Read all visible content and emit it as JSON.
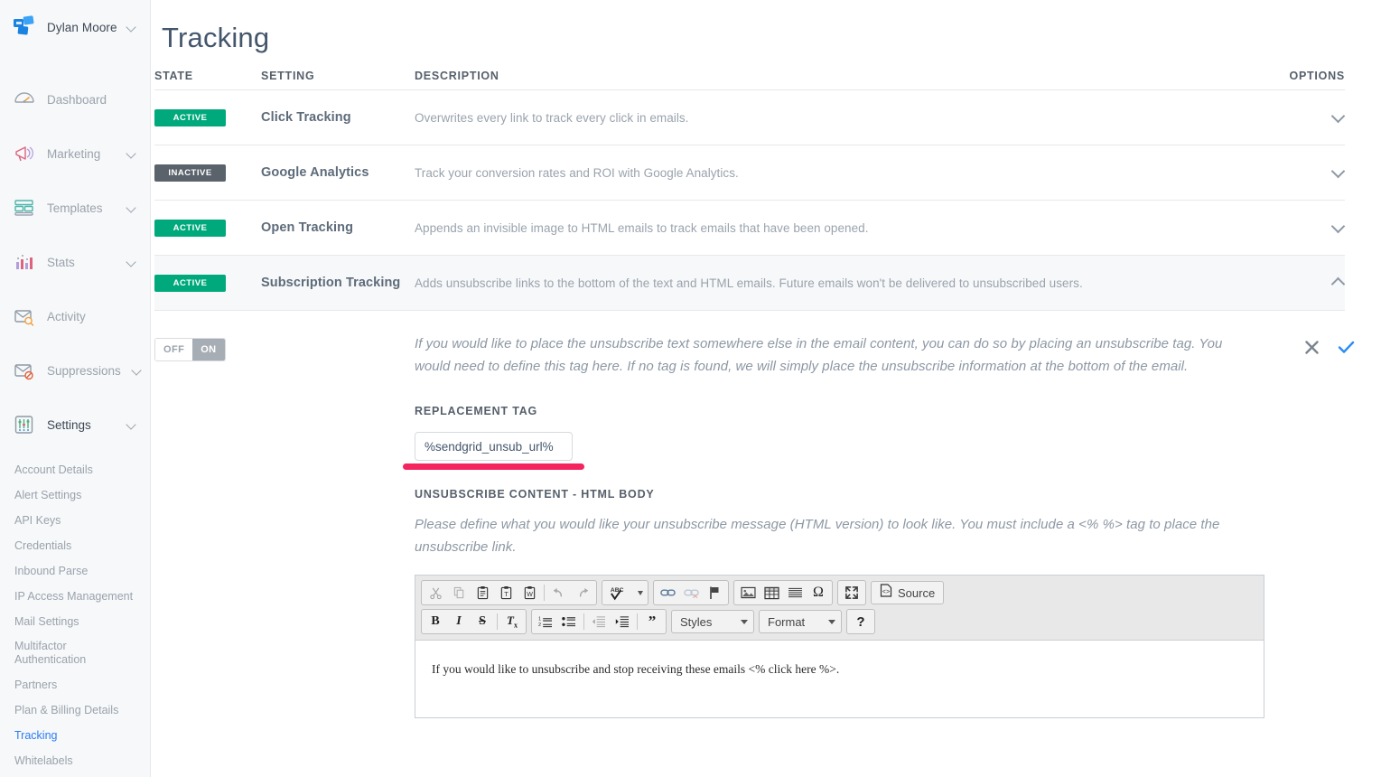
{
  "sidebar": {
    "account": {
      "name": "Dylan Moore",
      "logo_icon": "sendgrid-logo-icon",
      "chevron_icon": "chevron-down-icon"
    },
    "items": [
      {
        "label": "Dashboard",
        "icon": "gauge-icon",
        "has_chevron": false
      },
      {
        "label": "Marketing",
        "icon": "megaphone-icon",
        "has_chevron": true
      },
      {
        "label": "Templates",
        "icon": "template-icon",
        "has_chevron": true
      },
      {
        "label": "Stats",
        "icon": "bar-chart-icon",
        "has_chevron": true
      },
      {
        "label": "Activity",
        "icon": "envelope-search-icon",
        "has_chevron": false
      },
      {
        "label": "Suppressions",
        "icon": "envelope-block-icon",
        "has_chevron": true
      },
      {
        "label": "Settings",
        "icon": "sliders-icon",
        "has_chevron": true
      }
    ],
    "settings_subitems": [
      {
        "label": "Account Details",
        "selected": false
      },
      {
        "label": "Alert Settings",
        "selected": false
      },
      {
        "label": "API Keys",
        "selected": false
      },
      {
        "label": "Credentials",
        "selected": false
      },
      {
        "label": "Inbound Parse",
        "selected": false
      },
      {
        "label": "IP Access Management",
        "selected": false
      },
      {
        "label": "Mail Settings",
        "selected": false
      },
      {
        "label": "Multifactor Authentication",
        "selected": false
      },
      {
        "label": "Partners",
        "selected": false
      },
      {
        "label": "Plan & Billing Details",
        "selected": false
      },
      {
        "label": "Tracking",
        "selected": true
      },
      {
        "label": "Whitelabels",
        "selected": false
      }
    ]
  },
  "page": {
    "title": "Tracking"
  },
  "table": {
    "headers": {
      "state": "STATE",
      "setting": "SETTING",
      "description": "DESCRIPTION",
      "options": "OPTIONS"
    },
    "rows": [
      {
        "state": "ACTIVE",
        "state_kind": "active",
        "setting": "Click Tracking",
        "description": "Overwrites every link to track every click in emails.",
        "chevron": "chevron-down-icon",
        "expanded": false
      },
      {
        "state": "INACTIVE",
        "state_kind": "inactive",
        "setting": "Google Analytics",
        "description": "Track your conversion rates and ROI with Google Analytics.",
        "chevron": "chevron-down-icon",
        "expanded": false
      },
      {
        "state": "ACTIVE",
        "state_kind": "active",
        "setting": "Open Tracking",
        "description": "Appends an invisible image to HTML emails to track emails that have been opened.",
        "chevron": "chevron-down-icon",
        "expanded": false
      },
      {
        "state": "ACTIVE",
        "state_kind": "active",
        "setting": "Subscription Tracking",
        "description": "Adds unsubscribe links to the bottom of the text and HTML emails. Future emails won't be delivered to unsubscribed users.",
        "chevron": "chevron-up-icon",
        "expanded": true
      }
    ]
  },
  "expanded_panel": {
    "toggle": {
      "off_label": "OFF",
      "on_label": "ON",
      "value": "ON"
    },
    "intro_note": "If you would like to place the unsubscribe text somewhere else in the email content, you can do so by placing an unsubscribe tag. You would need to define this tag here. If no tag is found, we will simply place the unsubscribe information at the bottom of the email.",
    "replacement_tag": {
      "label": "REPLACEMENT TAG",
      "value": "%sendgrid_unsub_url%",
      "placeholder": "%sendgrid_unsub_url%",
      "underline_color": "#f4245e"
    },
    "unsubscribe_content": {
      "label": "UNSUBSCRIBE CONTENT - HTML BODY",
      "note": "Please define what you would like your unsubscribe message (HTML version) to look like. You must include a <% %> tag to place the unsubscribe link."
    },
    "actions": {
      "cancel_icon": "close-x-icon",
      "confirm_icon": "check-icon",
      "cancel_color": "#7b858f",
      "confirm_color": "#2a8cf6"
    }
  },
  "editor": {
    "toolbar_row1": [
      {
        "icon": "cut-icon",
        "glyph": "✂",
        "disabled": true
      },
      {
        "icon": "copy-icon",
        "glyph": "❐",
        "disabled": true
      },
      {
        "icon": "paste-icon",
        "glyph": "ὌB",
        "disabled": false
      },
      {
        "icon": "paste-as-text-icon",
        "glyph": "T",
        "disabled": false
      },
      {
        "icon": "paste-from-word-icon",
        "glyph": "W",
        "disabled": false
      },
      {
        "icon": "undo-icon",
        "glyph": "↶",
        "disabled": true
      },
      {
        "icon": "redo-icon",
        "glyph": "↷",
        "disabled": true
      },
      {
        "icon": "spell-check-icon",
        "glyph": "ABC",
        "disabled": false
      },
      {
        "icon": "link-icon",
        "glyph": "ὑ7",
        "disabled": false
      },
      {
        "icon": "unlink-icon",
        "glyph": "ὑ7",
        "disabled": true
      },
      {
        "icon": "anchor-flag-icon",
        "glyph": "⚑",
        "disabled": false
      },
      {
        "icon": "image-icon",
        "glyph": "ὛC",
        "disabled": false
      },
      {
        "icon": "table-icon",
        "glyph": "⊞",
        "disabled": false
      },
      {
        "icon": "horizontal-rule-icon",
        "glyph": "≡",
        "disabled": false
      },
      {
        "icon": "special-char-icon",
        "glyph": "Ω",
        "disabled": false
      },
      {
        "icon": "maximize-icon",
        "glyph": "⤢",
        "disabled": false
      }
    ],
    "source_button": {
      "label": "Source",
      "icon": "source-code-icon"
    },
    "toolbar_row2": [
      {
        "icon": "bold-icon",
        "glyph": "B",
        "disabled": false
      },
      {
        "icon": "italic-icon",
        "glyph": "I",
        "disabled": false
      },
      {
        "icon": "strikethrough-icon",
        "glyph": "S",
        "disabled": false
      },
      {
        "icon": "remove-format-icon",
        "glyph": "Tx",
        "disabled": false
      },
      {
        "icon": "numbered-list-icon",
        "glyph": "1.",
        "disabled": false
      },
      {
        "icon": "bulleted-list-icon",
        "glyph": "•",
        "disabled": false
      },
      {
        "icon": "outdent-icon",
        "glyph": "⇤",
        "disabled": true
      },
      {
        "icon": "indent-icon",
        "glyph": "⇥",
        "disabled": false
      },
      {
        "icon": "blockquote-icon",
        "glyph": "”",
        "disabled": false
      }
    ],
    "styles_dropdown": {
      "label": "Styles",
      "arrow_icon": "caret-down-icon"
    },
    "format_dropdown": {
      "label": "Format",
      "arrow_icon": "caret-down-icon"
    },
    "help_button": {
      "label": "?",
      "icon": "help-icon"
    },
    "content": "If you would like to unsubscribe and stop receiving these emails <% click here %>."
  }
}
